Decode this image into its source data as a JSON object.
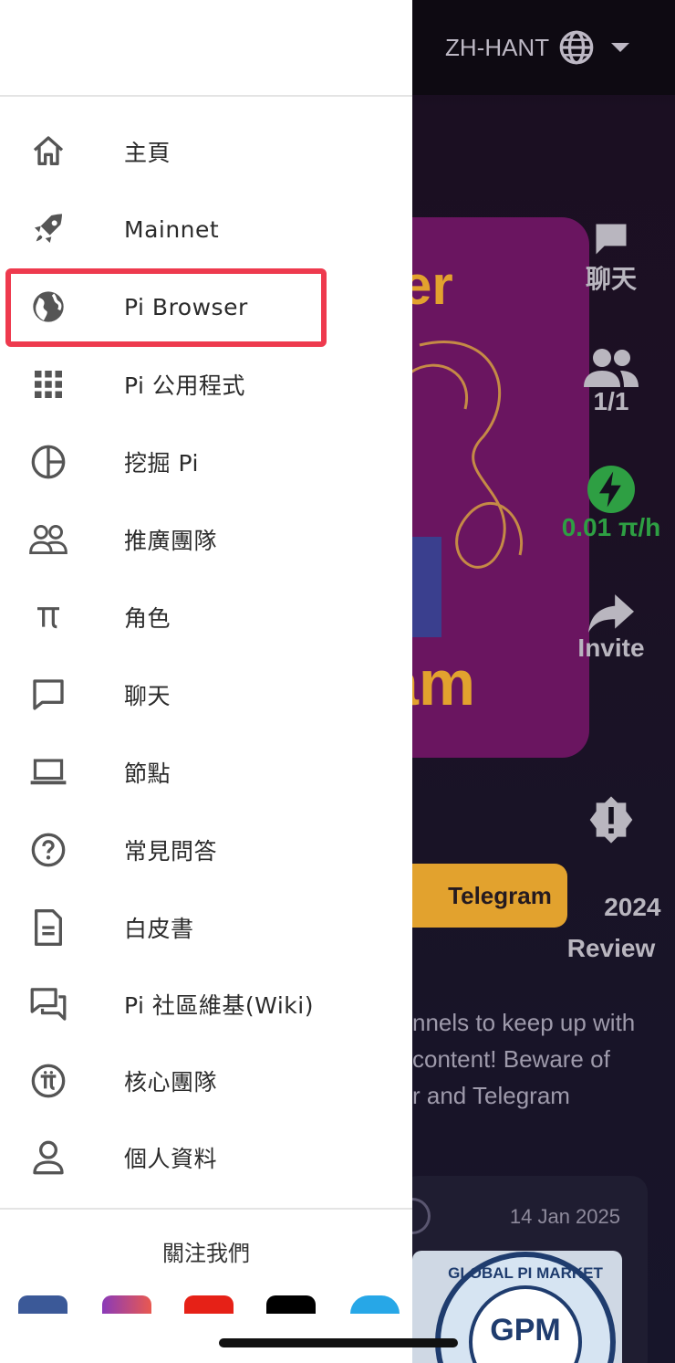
{
  "header": {
    "language": "ZH-HANT"
  },
  "drawer": {
    "items": [
      {
        "label": "主頁",
        "icon": "home-icon"
      },
      {
        "label": "Mainnet",
        "icon": "rocket-icon"
      },
      {
        "label": "Pi Browser",
        "icon": "globe-icon",
        "highlighted": true
      },
      {
        "label": "Pi 公用程式",
        "icon": "apps-grid-icon"
      },
      {
        "label": "挖掘 Pi",
        "icon": "pie-chart-icon"
      },
      {
        "label": "推廣團隊",
        "icon": "group-icon"
      },
      {
        "label": "角色",
        "icon": "pi-symbol-icon"
      },
      {
        "label": "聊天",
        "icon": "chat-bubble-icon"
      },
      {
        "label": "節點",
        "icon": "laptop-icon"
      },
      {
        "label": "常見問答",
        "icon": "question-icon"
      },
      {
        "label": "白皮書",
        "icon": "document-icon"
      },
      {
        "label": "Pi 社區維基(Wiki)",
        "icon": "forum-icon"
      },
      {
        "label": "核心團隊",
        "icon": "pi-coin-icon"
      },
      {
        "label": "個人資料",
        "icon": "person-icon"
      }
    ],
    "follow_label": "關注我們",
    "highlight_color": "#ee3a4e"
  },
  "background": {
    "promo": {
      "text_top": "er",
      "text_bottom": "am"
    },
    "rail": [
      {
        "label": "聊天",
        "icon": "chat-icon"
      },
      {
        "label": "1/1",
        "icon": "people-icon"
      },
      {
        "label": "0.01 π/h",
        "icon": "lightning-icon",
        "color": "#2e9f43"
      },
      {
        "label": "Invite",
        "icon": "share-arrow-icon"
      },
      {
        "label": "2024\nReview",
        "icon": "alert-badge-icon"
      }
    ],
    "telegram_button": "Telegram",
    "notice_text": "nnels to keep up with\ncontent! Beware of\nr and Telegram",
    "card": {
      "date": "14 Jan 2025",
      "thumb_text": "GPM",
      "thumb_ring": "GLOBAL PI MARKET"
    },
    "accent": "#e2a22e"
  }
}
